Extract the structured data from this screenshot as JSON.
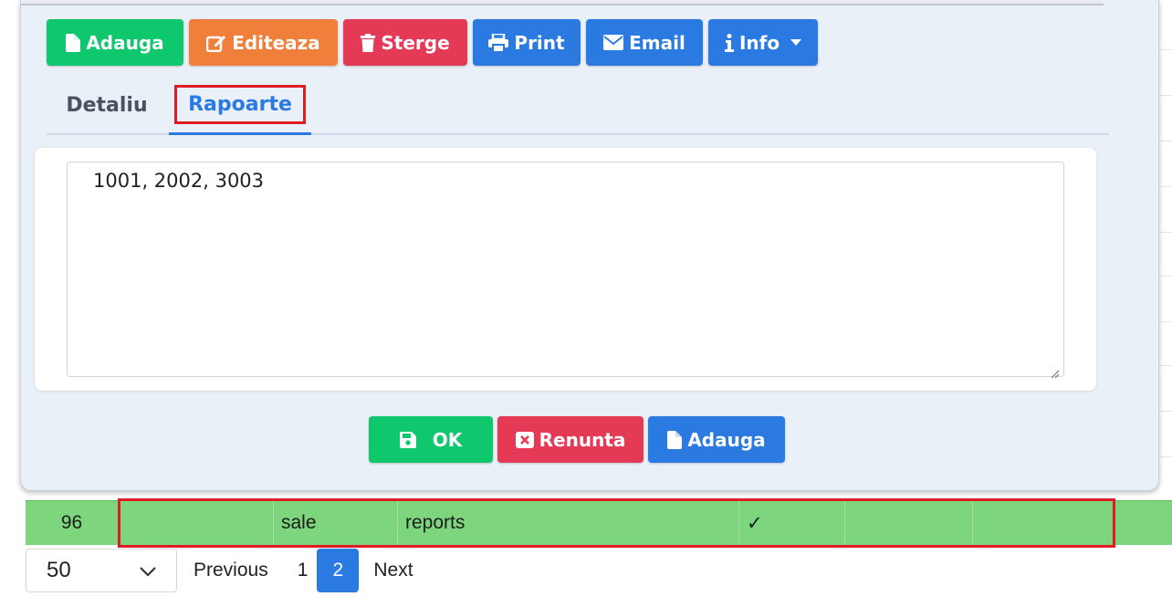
{
  "toolbar": {
    "add_label": "Adauga",
    "edit_label": "Editeaza",
    "delete_label": "Sterge",
    "print_label": "Print",
    "email_label": "Email",
    "info_label": "Info"
  },
  "tabs": [
    {
      "label": "Detaliu",
      "active": false
    },
    {
      "label": "Rapoarte",
      "active": true
    }
  ],
  "reports_textarea": {
    "value": "1001, 2002, 3003"
  },
  "footer": {
    "ok_label": "OK",
    "cancel_label": "Renunta",
    "add_label": "Adauga"
  },
  "table_row": {
    "cells": [
      "96",
      "",
      "sale",
      "reports",
      "✓",
      "",
      ""
    ]
  },
  "pagination": {
    "page_size": "50",
    "previous_label": "Previous",
    "pages": [
      "1",
      "2"
    ],
    "current_page": "2",
    "next_label": "Next"
  },
  "colors": {
    "green": "#0fc76d",
    "orange": "#f07f3c",
    "red": "#e43a56",
    "blue": "#2a7ae2",
    "row_green": "#7dd67d",
    "highlight_red": "#e01b24"
  },
  "icons": [
    "file-icon",
    "edit-icon",
    "trash-icon",
    "print-icon",
    "envelope-icon",
    "info-icon",
    "caret-down-icon",
    "save-icon",
    "close-box-icon",
    "chevron-down-icon",
    "scroll-up-icon",
    "scroll-down-icon"
  ]
}
